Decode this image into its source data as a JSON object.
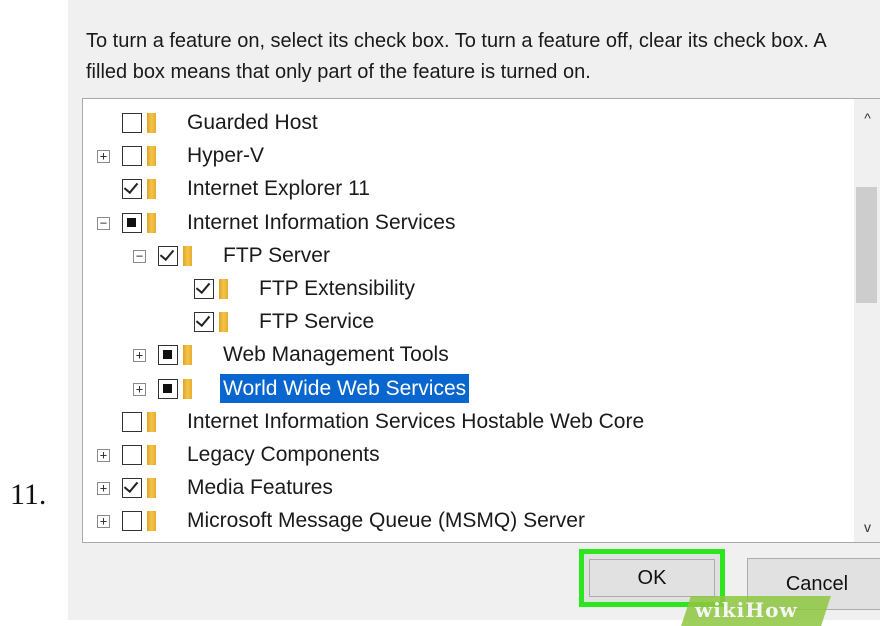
{
  "step_number": "11.",
  "instructions": "To turn a feature on, select its check box. To turn a feature off, clear its check box. A filled box means that only part of the feature is turned on.",
  "features": [
    {
      "label": "Guarded Host",
      "state": "unchecked",
      "expander": "",
      "level": 0
    },
    {
      "label": "Hyper-V",
      "state": "unchecked",
      "expander": "+",
      "level": 0
    },
    {
      "label": "Internet Explorer 11",
      "state": "checked",
      "expander": "",
      "level": 0
    },
    {
      "label": "Internet Information Services",
      "state": "partial",
      "expander": "−",
      "level": 0
    },
    {
      "label": "FTP Server",
      "state": "checked",
      "expander": "−",
      "level": 1
    },
    {
      "label": "FTP Extensibility",
      "state": "checked",
      "expander": "",
      "level": 2
    },
    {
      "label": "FTP Service",
      "state": "checked",
      "expander": "",
      "level": 2
    },
    {
      "label": "Web Management Tools",
      "state": "partial",
      "expander": "+",
      "level": 1
    },
    {
      "label": "World Wide Web Services",
      "state": "partial",
      "expander": "+",
      "level": 1,
      "selected": true
    },
    {
      "label": "Internet Information Services Hostable Web Core",
      "state": "unchecked",
      "expander": "",
      "level": 0
    },
    {
      "label": "Legacy Components",
      "state": "unchecked",
      "expander": "+",
      "level": 0
    },
    {
      "label": "Media Features",
      "state": "checked",
      "expander": "+",
      "level": 0
    },
    {
      "label": "Microsoft Message Queue (MSMQ) Server",
      "state": "unchecked",
      "expander": "+",
      "level": 0
    }
  ],
  "scrollbar": {
    "up_glyph": "^",
    "down_glyph": "v"
  },
  "buttons": {
    "ok_label": "OK",
    "cancel_label": "Cancel"
  },
  "watermark": "wikiHow",
  "colors": {
    "highlight_border": "#2ee61d",
    "selection": "#0a66cf",
    "folder": "#f4c44c"
  }
}
